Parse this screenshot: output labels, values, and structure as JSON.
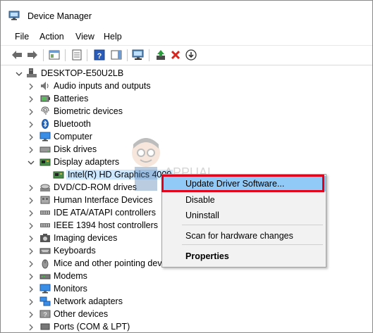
{
  "window": {
    "title": "Device Manager"
  },
  "menu": [
    "File",
    "Action",
    "View",
    "Help"
  ],
  "toolbar": {
    "buttons": [
      "back-icon",
      "forward-icon",
      "show-hide-console-tree-icon",
      "properties-icon",
      "help-icon",
      "show-action-pane-icon",
      "scan-hardware-icon",
      "update-driver-icon",
      "uninstall-icon",
      "download-icon"
    ]
  },
  "tree": {
    "root": "DESKTOP-E50U2LB",
    "items": [
      {
        "label": "Audio inputs and outputs",
        "icon": "audio-icon"
      },
      {
        "label": "Batteries",
        "icon": "battery-icon"
      },
      {
        "label": "Biometric devices",
        "icon": "biometric-icon"
      },
      {
        "label": "Bluetooth",
        "icon": "bluetooth-icon"
      },
      {
        "label": "Computer",
        "icon": "computer-icon"
      },
      {
        "label": "Disk drives",
        "icon": "disk-icon"
      },
      {
        "label": "Display adapters",
        "icon": "display-adapter-icon",
        "expanded": true
      },
      {
        "label": "Intel(R) HD Graphics 4000",
        "icon": "display-adapter-icon",
        "child": true
      },
      {
        "label": "DVD/CD-ROM drives",
        "icon": "dvd-icon"
      },
      {
        "label": "Human Interface Devices",
        "icon": "hid-icon"
      },
      {
        "label": "IDE ATA/ATAPI controllers",
        "icon": "ide-icon"
      },
      {
        "label": "IEEE 1394 host controllers",
        "icon": "ieee1394-icon"
      },
      {
        "label": "Imaging devices",
        "icon": "camera-icon"
      },
      {
        "label": "Keyboards",
        "icon": "keyboard-icon"
      },
      {
        "label": "Mice and other pointing devices",
        "icon": "mouse-icon"
      },
      {
        "label": "Modems",
        "icon": "modem-icon"
      },
      {
        "label": "Monitors",
        "icon": "monitor-icon"
      },
      {
        "label": "Network adapters",
        "icon": "network-icon"
      },
      {
        "label": "Other devices",
        "icon": "other-devices-icon"
      },
      {
        "label": "Ports (COM & LPT)",
        "icon": "ports-icon"
      }
    ]
  },
  "context_menu": {
    "items": [
      {
        "label": "Update Driver Software...",
        "highlighted": true
      },
      {
        "label": "Disable"
      },
      {
        "label": "Uninstall"
      },
      {
        "label": "Scan for hardware changes"
      },
      {
        "label": "Properties",
        "bold": true
      }
    ]
  },
  "watermark": {
    "text": "APPUALS"
  },
  "colors": {
    "highlight": "#91c9f7",
    "annotation": "#e2001a",
    "selection": "#cde8ff"
  }
}
